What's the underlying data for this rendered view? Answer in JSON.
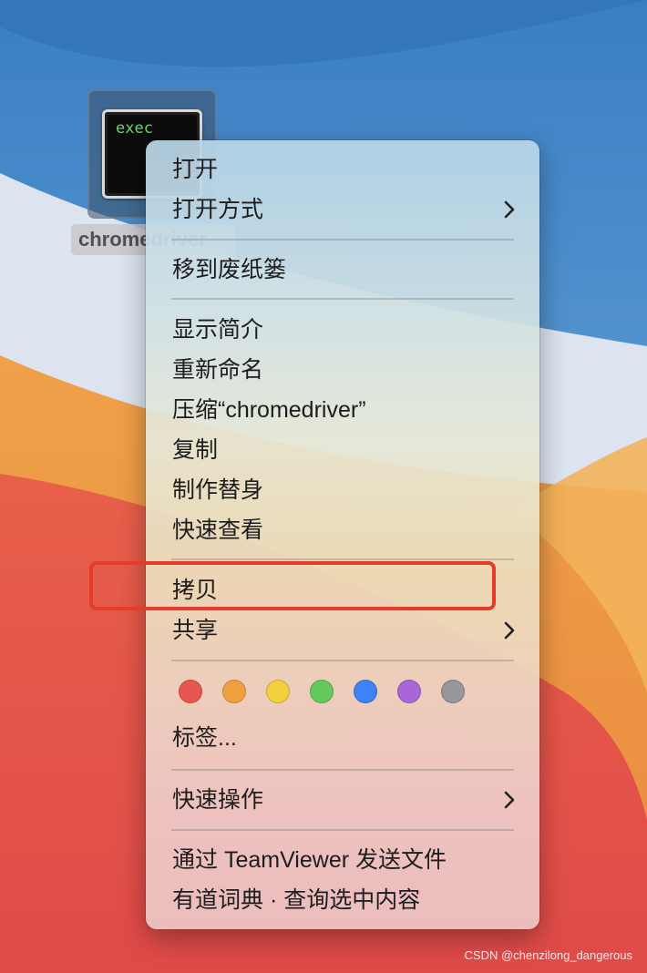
{
  "desktop": {
    "icon_text": "exec",
    "icon_label": "chromedriver"
  },
  "menu": {
    "open": "打开",
    "open_with": "打开方式",
    "move_to_trash": "移到废纸篓",
    "get_info": "显示简介",
    "rename": "重新命名",
    "compress": "压缩“chromedriver”",
    "duplicate": "复制",
    "make_alias": "制作替身",
    "quick_look": "快速查看",
    "copy": "拷贝",
    "share": "共享",
    "tags": "标签...",
    "quick_actions": "快速操作",
    "teamviewer": "通过 TeamViewer 发送文件",
    "youdao": "有道词典 · 查询选中内容"
  },
  "tag_colors": {
    "red": "#e8574f",
    "orange": "#efa13f",
    "yellow": "#f2d03e",
    "green": "#63c95a",
    "blue": "#3d82f6",
    "purple": "#a866d6",
    "gray": "#97979b"
  },
  "annotation": {
    "highlight_color": "#e63a2a"
  },
  "watermark": "CSDN @chenzilong_dangerous"
}
